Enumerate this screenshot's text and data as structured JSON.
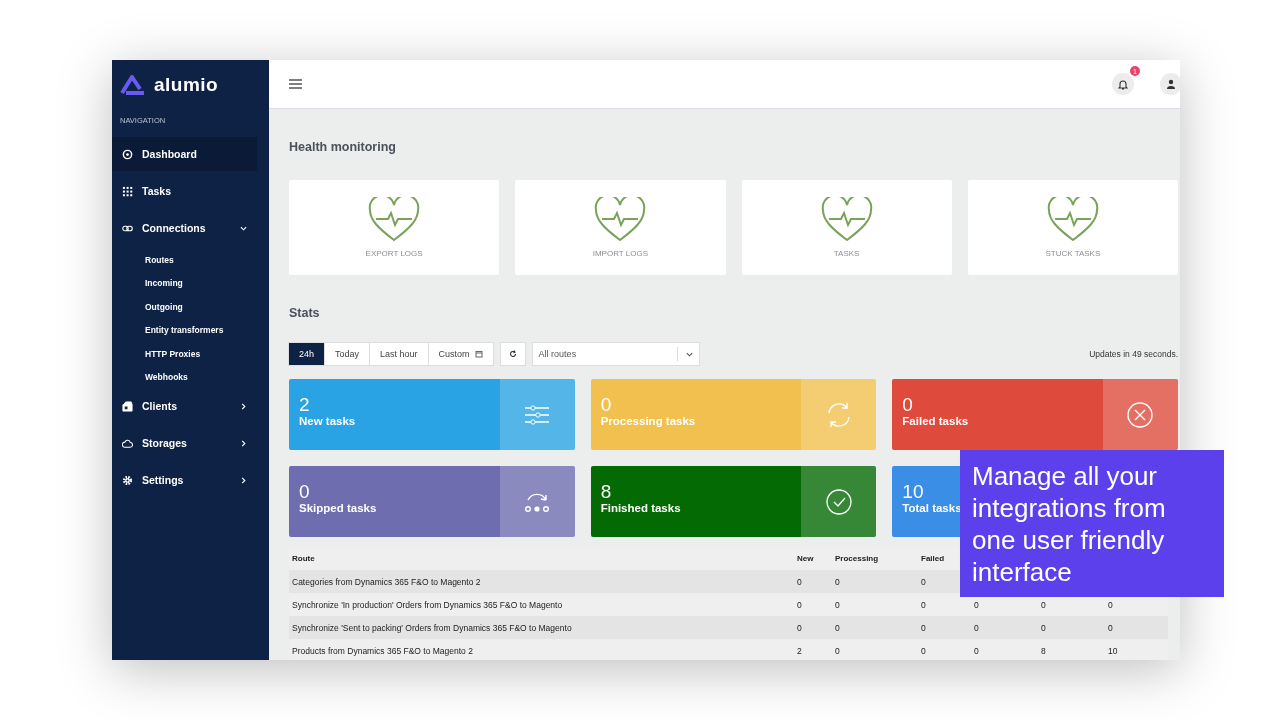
{
  "logo": {
    "text": "alumio"
  },
  "sidebar": {
    "heading": "NAVIGATION",
    "items": [
      {
        "label": "Dashboard",
        "selected": true
      },
      {
        "label": "Tasks",
        "selected": false
      },
      {
        "label": "Connections",
        "selected": false,
        "expanded": true,
        "children": [
          {
            "label": "Routes"
          },
          {
            "label": "Incoming"
          },
          {
            "label": "Outgoing"
          },
          {
            "label": "Entity transformers"
          },
          {
            "label": "HTTP Proxies"
          },
          {
            "label": "Webhooks"
          }
        ]
      },
      {
        "label": "Clients",
        "selected": false,
        "expanded": false
      },
      {
        "label": "Storages",
        "selected": false,
        "expanded": false
      },
      {
        "label": "Settings",
        "selected": false,
        "expanded": false
      }
    ]
  },
  "header": {
    "notification_count": "1"
  },
  "health": {
    "title": "Health monitoring",
    "cards": [
      {
        "label": "EXPORT LOGS"
      },
      {
        "label": "IMPORT LOGS"
      },
      {
        "label": "TASKS"
      },
      {
        "label": "STUCK TASKS"
      }
    ]
  },
  "stats": {
    "title": "Stats",
    "ranges": [
      {
        "label": "24h",
        "selected": true
      },
      {
        "label": "Today",
        "selected": false
      },
      {
        "label": "Last hour",
        "selected": false
      },
      {
        "label": "Custom",
        "selected": false
      }
    ],
    "route_select": {
      "value": "All routes"
    },
    "update_note": "Updates in 49 seconds.",
    "cards": [
      {
        "value": "2",
        "label": "New tasks",
        "color": "#29a3e3"
      },
      {
        "value": "0",
        "label": "Processing tasks",
        "color": "#f2c04f"
      },
      {
        "value": "0",
        "label": "Failed tasks",
        "color": "#de4b3d"
      },
      {
        "value": "0",
        "label": "Skipped tasks",
        "color": "#6e6db0"
      },
      {
        "value": "8",
        "label": "Finished tasks",
        "color": "#046a04"
      },
      {
        "value": "10",
        "label": "Total tasks",
        "color": "#3a8ee6"
      }
    ]
  },
  "table": {
    "columns": [
      "Route",
      "New",
      "Processing",
      "Failed"
    ],
    "rows": [
      [
        "Categories from Dynamics 365 F&O to Magento 2",
        "0",
        "0",
        "0"
      ],
      [
        "Synchronize 'In production' Orders from Dynamics 365 F&O to Magento",
        "0",
        "0",
        "0",
        "0",
        "0",
        "0"
      ],
      [
        "Synchronize 'Sent to packing' Orders from Dynamics 365 F&O to Magento",
        "0",
        "0",
        "0",
        "0",
        "0",
        "0"
      ],
      [
        "Products from Dynamics 365 F&O to Magento 2",
        "2",
        "0",
        "0",
        "0",
        "8",
        "10"
      ]
    ]
  },
  "callout": {
    "text": "Manage all your integrations from one user friendly interface"
  }
}
